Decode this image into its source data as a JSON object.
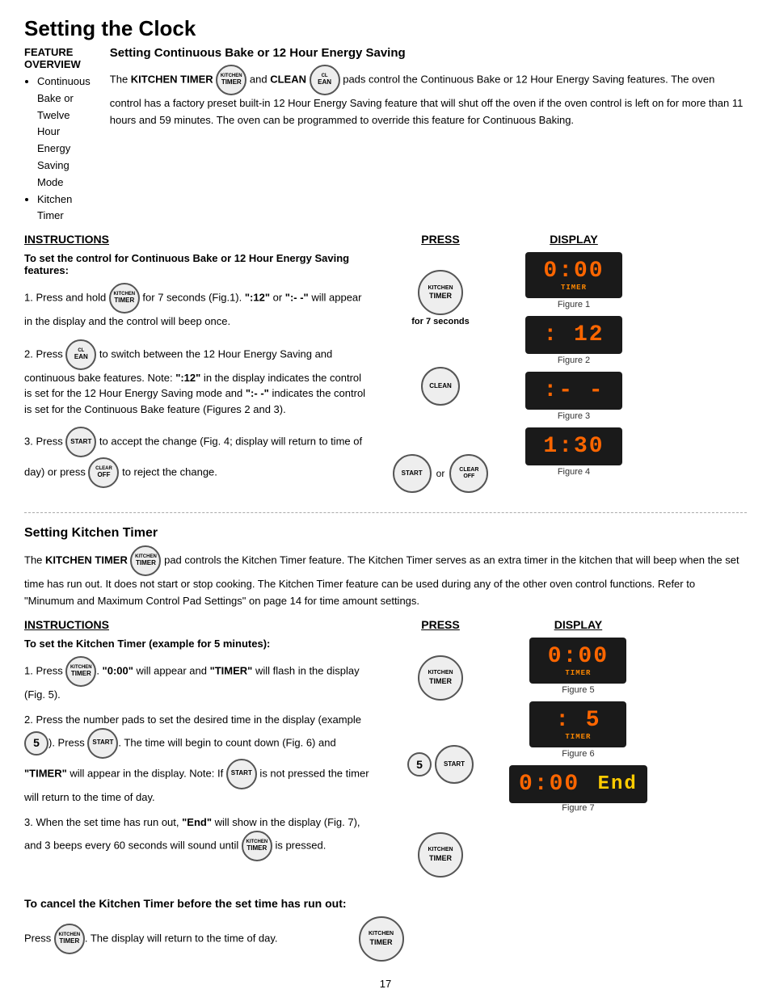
{
  "page": {
    "title": "Setting the Clock",
    "page_number": "17"
  },
  "feature_overview": {
    "heading": "FEATURE OVERVIEW",
    "items": [
      "Continuous Bake or Twelve Hour Energy Saving Mode",
      "Kitchen Timer"
    ]
  },
  "continuous_bake": {
    "heading": "Setting Continuous Bake or 12 Hour Energy Saving",
    "paragraph1": "The KITCHEN TIMER",
    "paragraph1b": "and CLEAN",
    "paragraph1c": "pads control the Continuous Bake or 12 Hour Energy Saving features. The oven control has a factory preset built-in 12 Hour Energy Saving feature that will shut off the oven if the oven control is left on for more than 11 hours and 59 minutes. The oven can be programmed to override this feature for Continuous Baking."
  },
  "columns": {
    "instructions": "INSTRUCTIONS",
    "press": "PRESS",
    "display": "DISPLAY"
  },
  "cb_instructions": {
    "heading": "To set the control for Continuous Bake or 12 Hour Energy Saving features:",
    "steps": [
      "Press and hold  for 7 seconds (Fig.1). \":12\" or \":- -\"  will appear in the display and the control will beep once.",
      "Press  to switch between the 12 Hour Energy Saving and continuous bake features. Note: \":12\" in the display indicates the control is set for the 12 Hour Energy Saving mode and \":- -\" indicates the control is set for the Continuous Bake feature (Figures 2 and 3).",
      "Press  to accept the change (Fig. 4; display will return to time of day) or press  to reject the change."
    ]
  },
  "cb_press": [
    {
      "label": "for 7 seconds",
      "btn": "KITCHEN\nTIMER"
    },
    {
      "label": "",
      "btn": "CLEAN"
    },
    {
      "label": "or",
      "btn1": "START",
      "btn2": "CLEAR\nOFF"
    }
  ],
  "cb_display": [
    {
      "value": "0:00",
      "sublabel": "TIMER",
      "caption": "Figure 1"
    },
    {
      "value": ": 12",
      "caption": "Figure 2"
    },
    {
      "value": ":- -",
      "caption": "Figure 3"
    },
    {
      "value": "1:30",
      "caption": "Figure 4"
    }
  ],
  "kitchen_timer": {
    "section_heading": "Setting Kitchen Timer",
    "body": "The KITCHEN TIMER  pad controls the Kitchen Timer feature. The Kitchen Timer serves as an extra timer in the kitchen that will beep when the set time has run out. It does not start or stop cooking. The Kitchen Timer feature can be used during any of the other oven control functions. Refer to \"Minumum and Maximum Control Pad Settings\" on page 14 for time amount settings."
  },
  "kt_instructions": {
    "heading": "To set the Kitchen Timer (example for 5 minutes):",
    "steps": [
      "Press . \"0:00\" will appear and \"TIMER\" will flash in the display (Fig. 5).",
      "Press the number pads to set the desired time in the display (example 5). Press START. The time will begin to count down (Fig. 6) and \"TIMER\" will appear in the display. Note: If START is not pressed the timer will return to the time of day.",
      "When the set time has run out, \"End\" will show in the display (Fig. 7), and 3 beeps every 60 seconds will sound until  is pressed."
    ]
  },
  "kt_press": [
    {
      "btn": "KITCHEN\nTIMER"
    },
    {
      "btn1": "5",
      "btn2": "START"
    },
    {
      "btn": "KITCHEN\nTIMER"
    }
  ],
  "kt_display": [
    {
      "value": "0:00",
      "sublabel": "TIMER",
      "caption": "Figure 5"
    },
    {
      "value": ": 5",
      "sublabel": "TIMER",
      "caption": "Figure 6"
    },
    {
      "value": "0:00 End",
      "caption": "Figure 7"
    }
  ],
  "cancel_section": {
    "heading": "To cancel the Kitchen Timer before the set time has run out:",
    "press_text": "Press",
    "text": ". The display will return to the time of day."
  }
}
